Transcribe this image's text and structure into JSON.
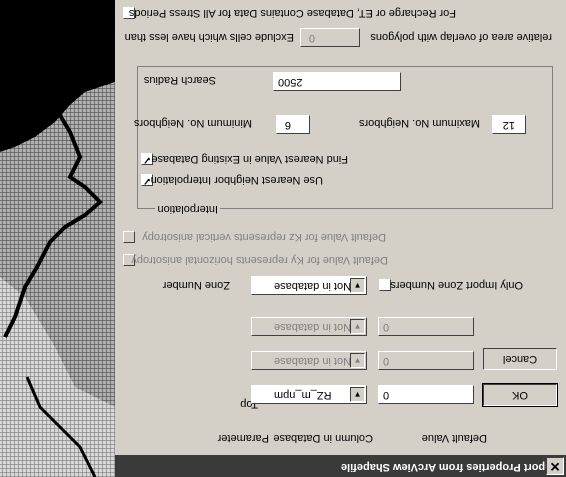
{
  "dialog": {
    "title": "Import Properties from ArcView Shapefile",
    "close_glyph": "✕",
    "columns": {
      "parameter": "Parameter",
      "column_in_database": "Column in Database",
      "default_value": "Default Value"
    },
    "rows": [
      {
        "parameter": "Top",
        "column": "RZ_m_npm",
        "default": "0",
        "enabled": true
      },
      {
        "parameter": "",
        "column": "Not in database",
        "default": "0",
        "enabled": false
      },
      {
        "parameter": "",
        "column": "Not in database",
        "default": "0",
        "enabled": false
      }
    ],
    "buttons": {
      "ok": "OK",
      "cancel": "Cancel"
    },
    "zone": {
      "label": "Zone Number",
      "column": "Not in database",
      "only_import_label": "Only Import Zone Numbers",
      "only_import_checked": false
    },
    "anisotropy": {
      "ky_label": "Default Value for Ky represents horizontal anisotropy",
      "kz_label": "Default Value for Kz represents vertical anisotropy"
    },
    "interpolation": {
      "title": "Interpolation",
      "use_nearest_label": "Use Nearest Neighbor Interpolation",
      "use_nearest_checked": true,
      "find_nearest_label": "Find Nearest Value in Existing Database",
      "find_nearest_checked": true,
      "min_neighbors_label": "Minimum No. Neighbors",
      "min_neighbors_value": "6",
      "max_neighbors_label": "Maximum No. Neighbors",
      "max_neighbors_value": "12",
      "search_radius_label": "Search Radius",
      "search_radius_value": "2500"
    },
    "exclude": {
      "prefix": "Exclude cells which have less than",
      "value": "0",
      "suffix": "relative area of overlap with polygons"
    },
    "recharge": {
      "label": "For Recharge or ET, Database Contains Data for All Stress Periods",
      "checked": false
    }
  }
}
